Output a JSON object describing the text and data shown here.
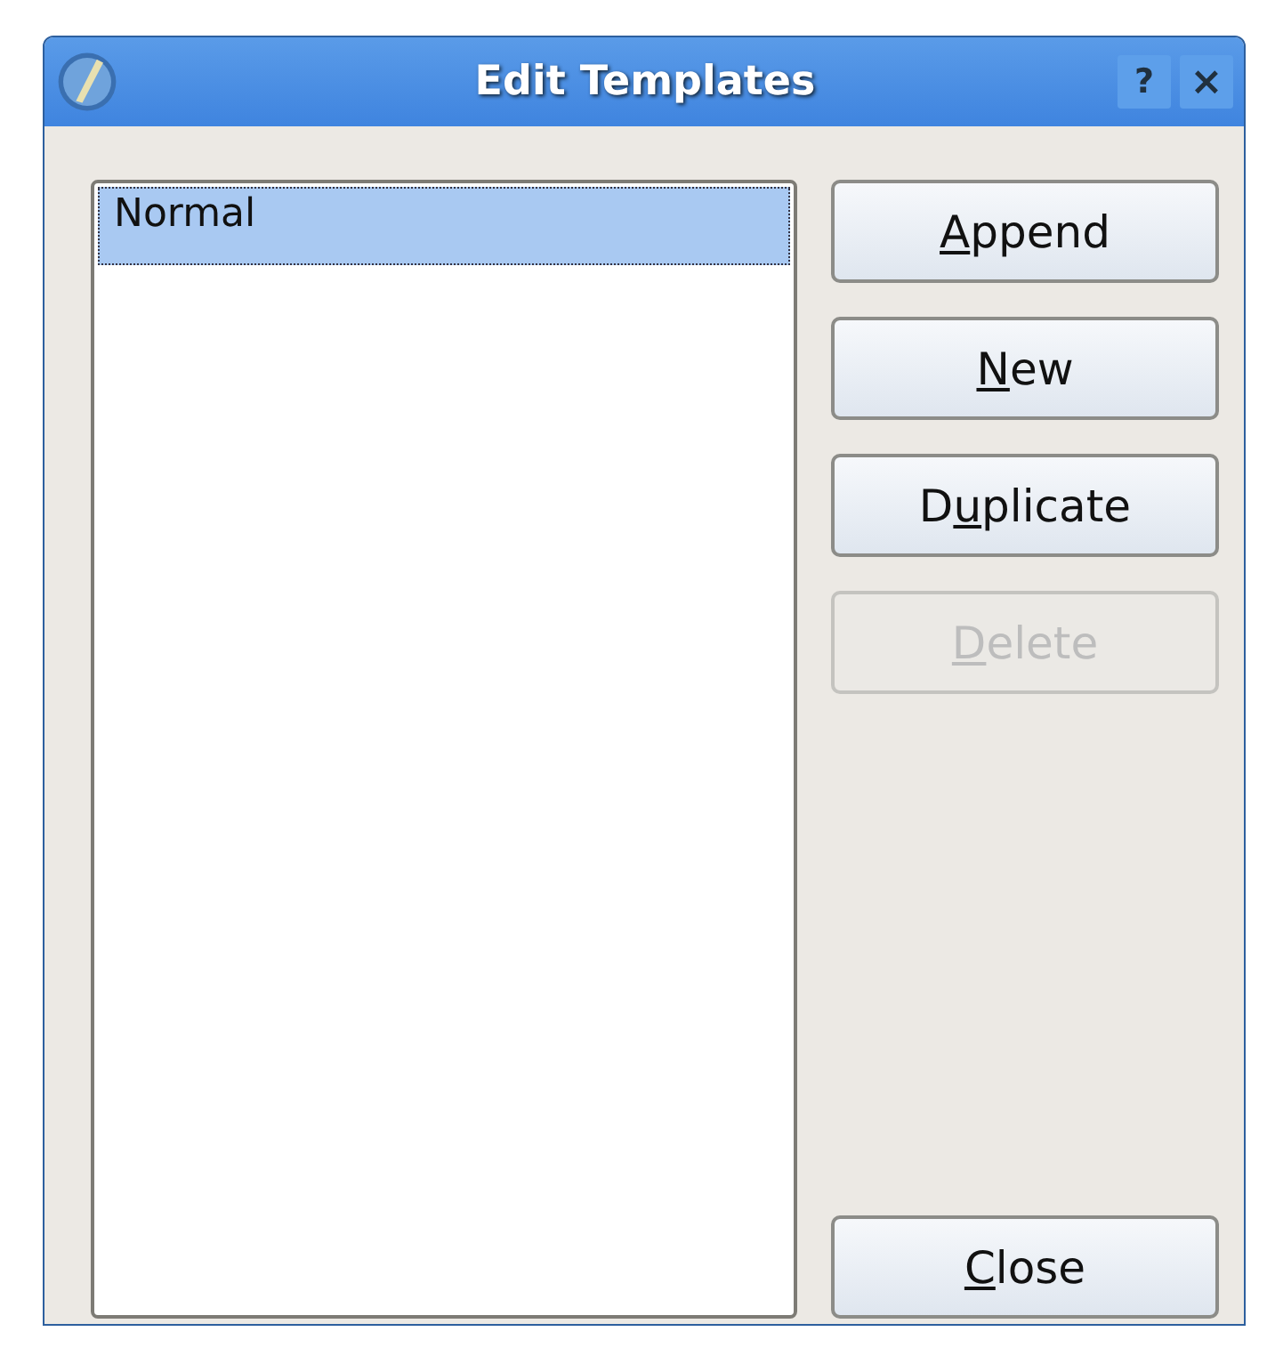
{
  "window": {
    "title": "Edit Templates",
    "title_buttons": [
      {
        "kind": "help",
        "label": "?"
      },
      {
        "kind": "close",
        "label": "×"
      }
    ]
  },
  "templates": [
    {
      "label": "Normal",
      "selected": true
    }
  ],
  "buttons": [
    {
      "key": "A",
      "post": "ppend",
      "disabled": false
    },
    {
      "key": "N",
      "post": "ew",
      "disabled": false
    },
    {
      "pre": "D",
      "key": "u",
      "post": "plicate",
      "disabled": false
    },
    {
      "key": "D",
      "post": "elete",
      "disabled": true
    }
  ],
  "close_button": {
    "key": "C",
    "post": "lose",
    "disabled": false
  }
}
